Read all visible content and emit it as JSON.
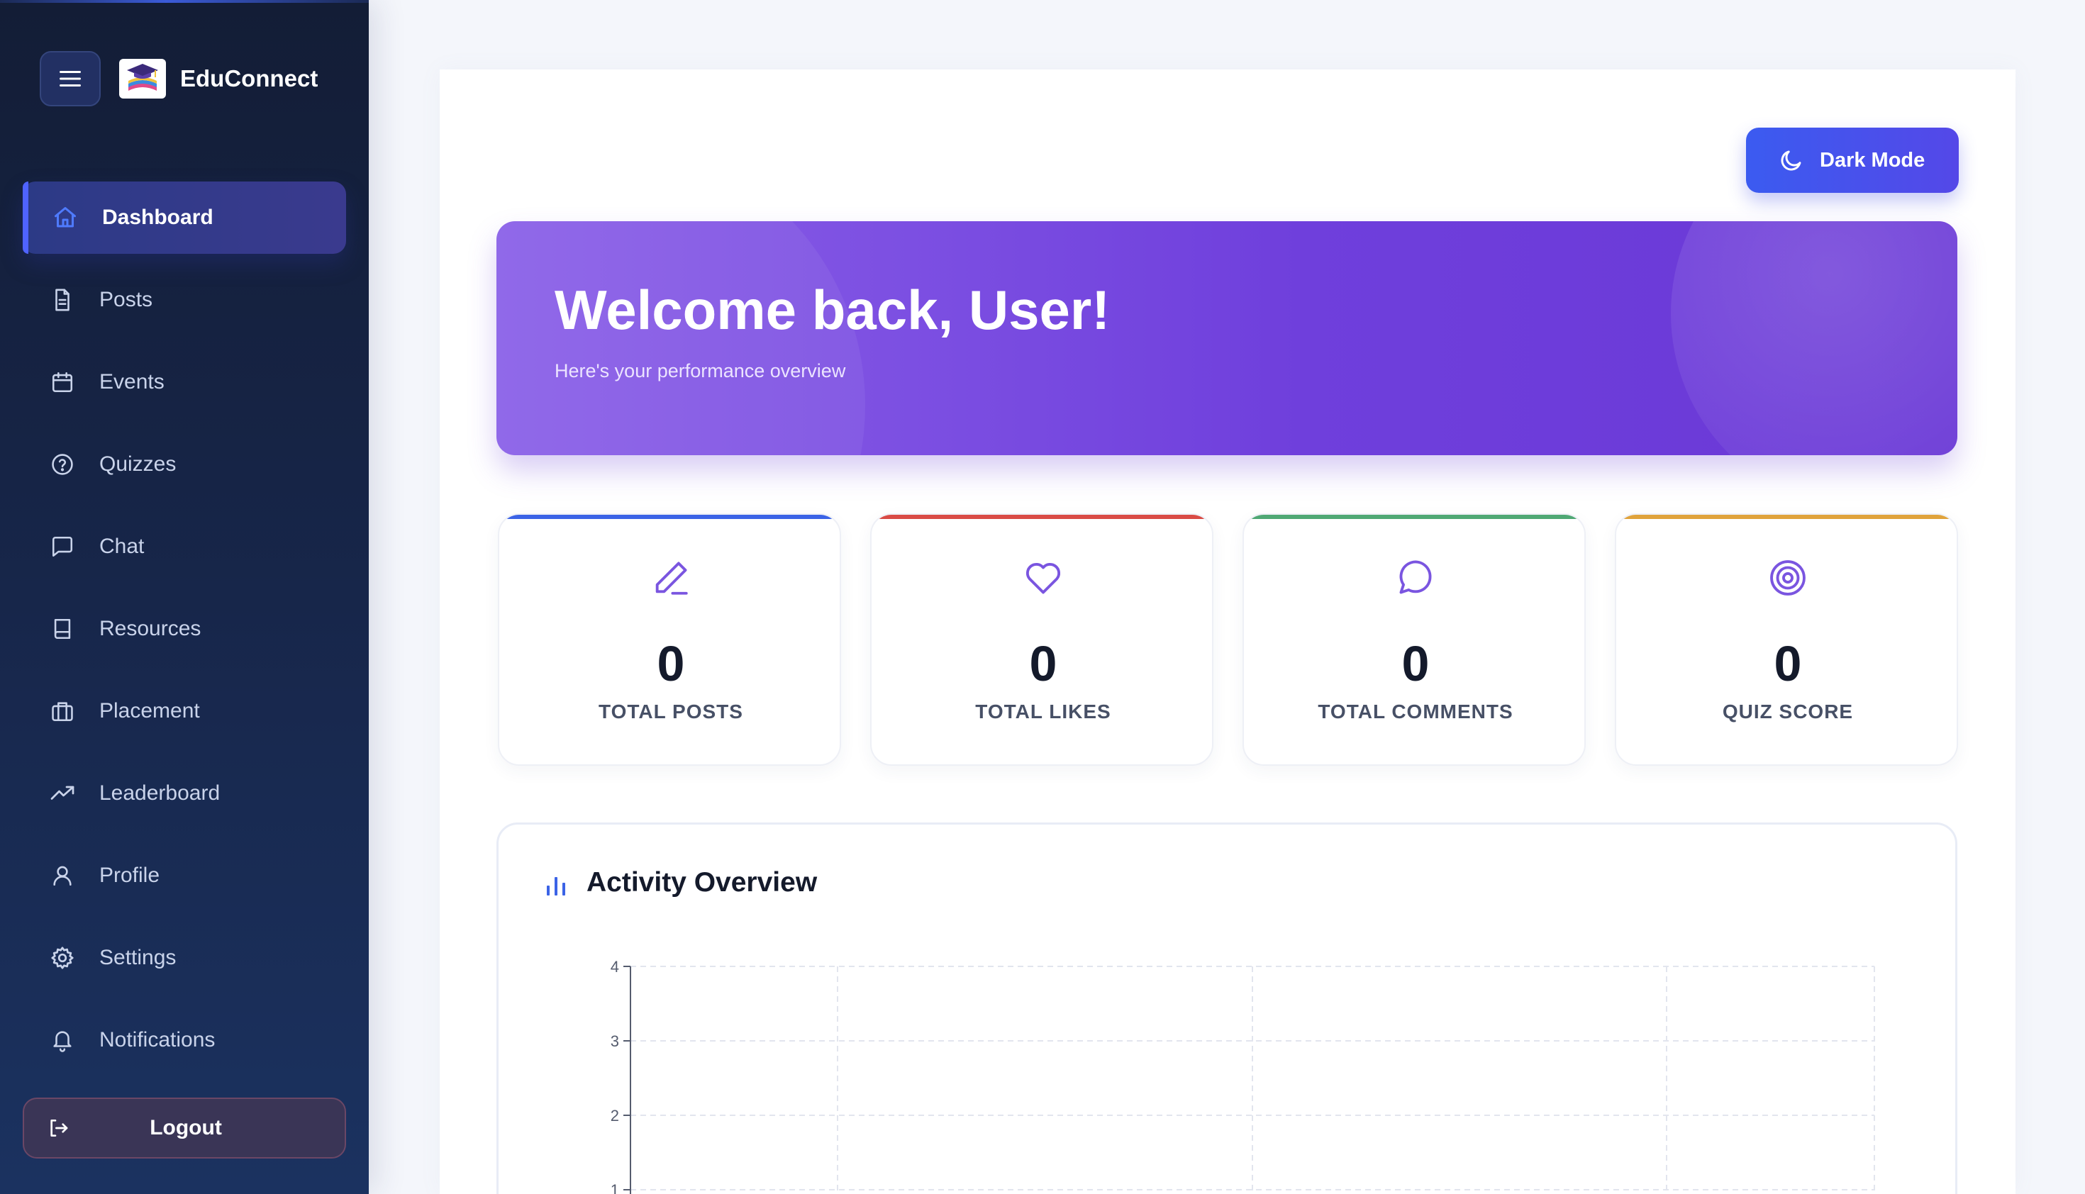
{
  "app": {
    "name": "EduConnect"
  },
  "sidebar": {
    "items": [
      {
        "label": "Dashboard",
        "icon": "home-icon",
        "active": true
      },
      {
        "label": "Posts",
        "icon": "document-icon"
      },
      {
        "label": "Events",
        "icon": "calendar-icon"
      },
      {
        "label": "Quizzes",
        "icon": "help-circle-icon"
      },
      {
        "label": "Chat",
        "icon": "message-square-icon"
      },
      {
        "label": "Resources",
        "icon": "book-icon"
      },
      {
        "label": "Placement",
        "icon": "briefcase-icon"
      },
      {
        "label": "Leaderboard",
        "icon": "trending-up-icon"
      },
      {
        "label": "Profile",
        "icon": "user-icon"
      },
      {
        "label": "Settings",
        "icon": "gear-icon"
      },
      {
        "label": "Notifications",
        "icon": "bell-icon"
      }
    ],
    "logout_label": "Logout"
  },
  "header": {
    "dark_mode_label": "Dark Mode"
  },
  "hero": {
    "title": "Welcome back, User!",
    "subtitle": "Here's your performance overview"
  },
  "stats": [
    {
      "value": "0",
      "label": "TOTAL POSTS",
      "icon": "pencil-icon",
      "accent": "#3b63e6"
    },
    {
      "value": "0",
      "label": "TOTAL LIKES",
      "icon": "heart-icon",
      "accent": "#d94b45"
    },
    {
      "value": "0",
      "label": "TOTAL COMMENTS",
      "icon": "message-circle-icon",
      "accent": "#4fa874"
    },
    {
      "value": "0",
      "label": "QUIZ SCORE",
      "icon": "target-icon",
      "accent": "#e0a33b"
    }
  ],
  "activity": {
    "title": "Activity Overview",
    "icon": "bar-chart-icon"
  },
  "chart_data": {
    "type": "line",
    "y_ticks": [
      "4",
      "3",
      "2",
      "1"
    ],
    "ylim": [
      1,
      4
    ],
    "grid": true,
    "series": []
  },
  "colors": {
    "accent": "#4f63ff",
    "icon_purple": "#7a55e0",
    "hero_start": "#8a60e8",
    "hero_end": "#6a38d6"
  }
}
